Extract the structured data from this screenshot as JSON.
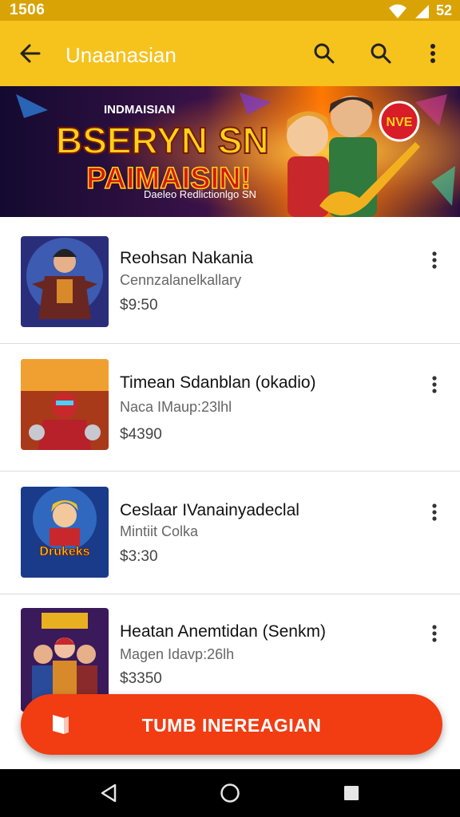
{
  "status_bar": {
    "time": "1506",
    "battery_text": "52"
  },
  "app_bar": {
    "title": "Unaanasian"
  },
  "banner": {
    "kicker": "INDMAISIAN",
    "headline_1": "BSERYN SN",
    "headline_2": "PAIMAISIN!",
    "caption": "Daeleo Redlictionlgo SN",
    "badge": "NVE",
    "colors": {
      "bg_dark": "#140a30",
      "bg_orange": "#ff7a00",
      "headline_yellow": "#ffd21a",
      "headline_red": "#d4180c"
    }
  },
  "items": [
    {
      "title": "Reohsan Nakania",
      "subtitle": "Cennzalanelkallary",
      "price": "$9:50",
      "thumb": "hero-armor-icon"
    },
    {
      "title": "Timean Sdanblan (okadio)",
      "subtitle": "Naca IMaup:23lhl",
      "price": "$4390",
      "thumb": "fighter-red-icon"
    },
    {
      "title": "Ceslaar IVanainyadeclal",
      "subtitle": "Mintiit Colka",
      "price": "$3:30",
      "thumb": "drukeks-logo-icon",
      "thumb_text": "Drukeks"
    },
    {
      "title": "Heatan Anemtidan (Senkm)",
      "subtitle": "Magen Idavp:26lh",
      "price": "$3350",
      "thumb": "group-heroes-icon"
    }
  ],
  "fab": {
    "label": "TUMB INEREAGIAN",
    "color": "#f23c12"
  },
  "colors": {
    "app_bar": "#f6c21c",
    "status_bar": "#d9a306"
  }
}
